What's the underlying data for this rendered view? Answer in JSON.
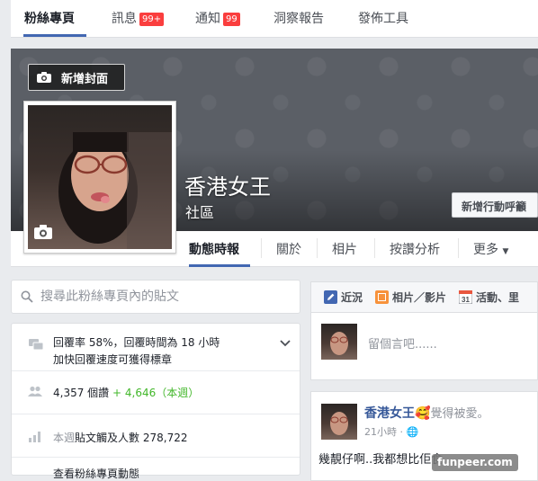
{
  "topnav": {
    "tabs": [
      {
        "label": "粉絲專頁"
      },
      {
        "label": "訊息",
        "badge": "99+"
      },
      {
        "label": "通知",
        "badge": "99"
      },
      {
        "label": "洞察報告"
      },
      {
        "label": "發佈工具"
      }
    ]
  },
  "cover": {
    "add_cover_label": "新增封面",
    "cta_label": "新增行動呼籲",
    "page_name": "香港女王",
    "page_category": "社區"
  },
  "page_tabs": [
    "動態時報",
    "關於",
    "相片",
    "按讚分析",
    "更多"
  ],
  "search": {
    "placeholder": "搜尋此粉絲專頁內的貼文"
  },
  "info": {
    "response_rate": "回覆率 58%，回覆時間為 18 小時",
    "response_hint": "加快回覆速度可獲得標章",
    "likes_count": "4,357 個讚",
    "likes_delta": "+ 4,646",
    "likes_period": "（本週）",
    "reach_prefix": "本週",
    "reach_label": "貼文觸及人數",
    "reach_value": "278,722",
    "cut_text": "查看粉絲專頁動態"
  },
  "composer": {
    "tab_status": "近況",
    "tab_photo": "相片／影片",
    "tab_event": "活動、里",
    "placeholder": "留個言吧......"
  },
  "post": {
    "author": "香港女王",
    "feeling": "覺得被愛。",
    "time": "21小時 ·",
    "text": "幾靚仔啊..我都想比佢食......"
  },
  "watermark": "funpeer.com",
  "colors": {
    "accent": "#4267b2",
    "badge": "#fa3e3e",
    "link": "#365899",
    "positive": "#42b72a"
  }
}
